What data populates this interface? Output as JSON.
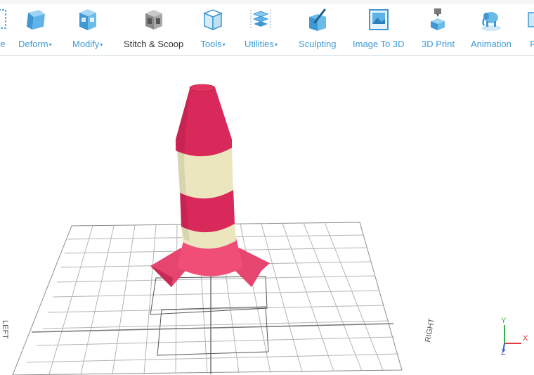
{
  "toolbar": {
    "partial_left_label": "e",
    "partial_right_label": "R",
    "items": [
      {
        "label": "Deform",
        "dropdown": true,
        "icon": "deform-cube-icon"
      },
      {
        "label": "Modify",
        "dropdown": true,
        "icon": "modify-cube-icon"
      },
      {
        "label": "Stitch & Scoop",
        "dropdown": false,
        "icon": "stitch-scoop-icon",
        "active": true
      },
      {
        "label": "Tools",
        "dropdown": true,
        "icon": "tools-cube-icon"
      },
      {
        "label": "Utilities",
        "dropdown": true,
        "icon": "utilities-stack-icon"
      },
      {
        "label": "Sculpting",
        "dropdown": false,
        "icon": "sculpting-icon"
      },
      {
        "label": "Image To 3D",
        "dropdown": false,
        "icon": "image-to-3d-icon"
      },
      {
        "label": "3D Print",
        "dropdown": false,
        "icon": "3d-print-icon"
      },
      {
        "label": "Animation",
        "dropdown": false,
        "icon": "animation-elephant-icon"
      }
    ],
    "caret": "▾"
  },
  "viewport": {
    "grid_left_label": "LEFT",
    "grid_right_label": "RIGHT",
    "axis": {
      "y": "Y",
      "x": "X",
      "z": "Z"
    }
  },
  "colors": {
    "accent": "#3d9bd6",
    "rocket_red": "#d9285a",
    "rocket_cream": "#ece6bf",
    "fins_pink": "#ee4d73",
    "axis_y": "#2fb04a",
    "axis_x": "#e23d3d",
    "axis_z": "#3a56d8"
  }
}
